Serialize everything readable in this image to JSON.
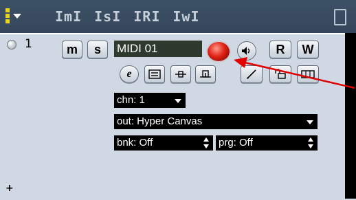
{
  "header": {
    "col_labels": [
      "ImI",
      "IsI",
      "IRI",
      "IwI"
    ]
  },
  "track": {
    "number": "1",
    "mute_label": "m",
    "solo_label": "s",
    "name": "MIDI 01",
    "read_label": "R",
    "write_label": "W"
  },
  "fields": {
    "channel": "chn: 1",
    "output": "out: Hyper Canvas",
    "bank": "bnk: Off",
    "program": "prg: Off"
  },
  "footer": {
    "add_label": "+"
  },
  "colors": {
    "header_bg": "#3d5166",
    "panel_bg": "#d0d9e3",
    "record": "#e02216",
    "arrow": "#e00000"
  }
}
